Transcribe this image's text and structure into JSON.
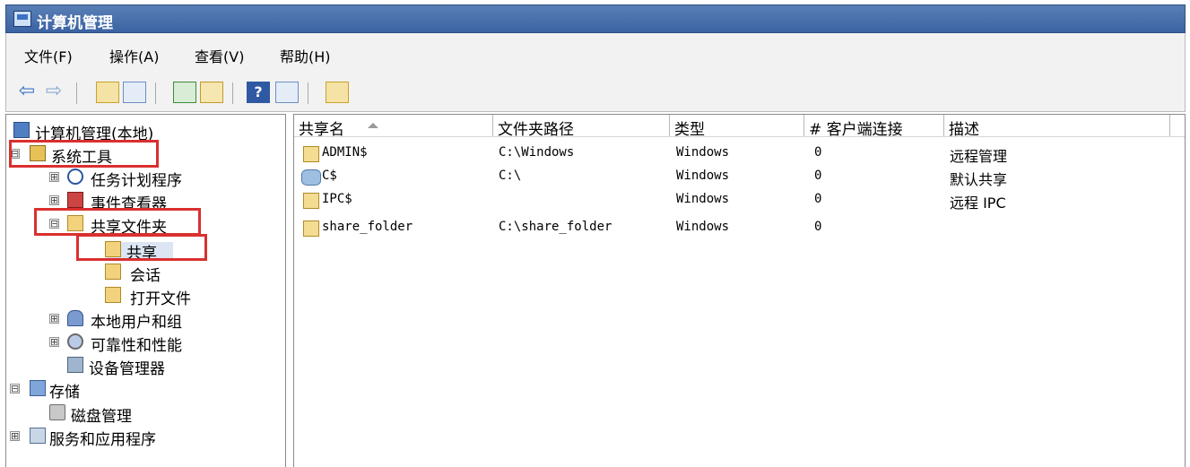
{
  "window": {
    "title": "计算机管理"
  },
  "menu": [
    "文件(F)",
    "操作(A)",
    "查看(V)",
    "帮助(H)"
  ],
  "toolbar": {
    "icons": [
      "back-icon",
      "forward-icon",
      "up-folder-icon",
      "show-hide-tree-icon",
      "refresh-icon",
      "export-icon",
      "help-icon",
      "properties-icon",
      "new-share-icon"
    ]
  },
  "tree": {
    "root": "计算机管理(本地)",
    "system_tools": "系统工具",
    "task_scheduler": "任务计划程序",
    "event_viewer": "事件查看器",
    "shared_folders": "共享文件夹",
    "shares": "共享",
    "sessions": "会话",
    "open_files": "打开文件",
    "local_users": "本地用户和组",
    "reliability": "可靠性和性能",
    "device_manager": "设备管理器",
    "storage": "存储",
    "disk_management": "磁盘管理",
    "services_apps": "服务和应用程序",
    "expanders": {
      "plus": "⊞",
      "minus": "⊟"
    }
  },
  "list": {
    "columns": [
      "共享名",
      "文件夹路径",
      "类型",
      "# 客户端连接",
      "描述"
    ],
    "rows": [
      {
        "name": "ADMIN$",
        "path": "C:\\Windows",
        "type": "Windows",
        "clients": "0",
        "desc": "远程管理"
      },
      {
        "name": "C$",
        "path": "C:\\",
        "type": "Windows",
        "clients": "0",
        "desc": "默认共享"
      },
      {
        "name": "IPC$",
        "path": "",
        "type": "Windows",
        "clients": "0",
        "desc": "远程 IPC"
      },
      {
        "name": "share_folder",
        "path": "C:\\share_folder",
        "type": "Windows",
        "clients": "0",
        "desc": ""
      }
    ]
  },
  "colors": {
    "title_bg": "#3c63a3",
    "highlight": "#d9302f",
    "selection": "#dbe5f3"
  }
}
